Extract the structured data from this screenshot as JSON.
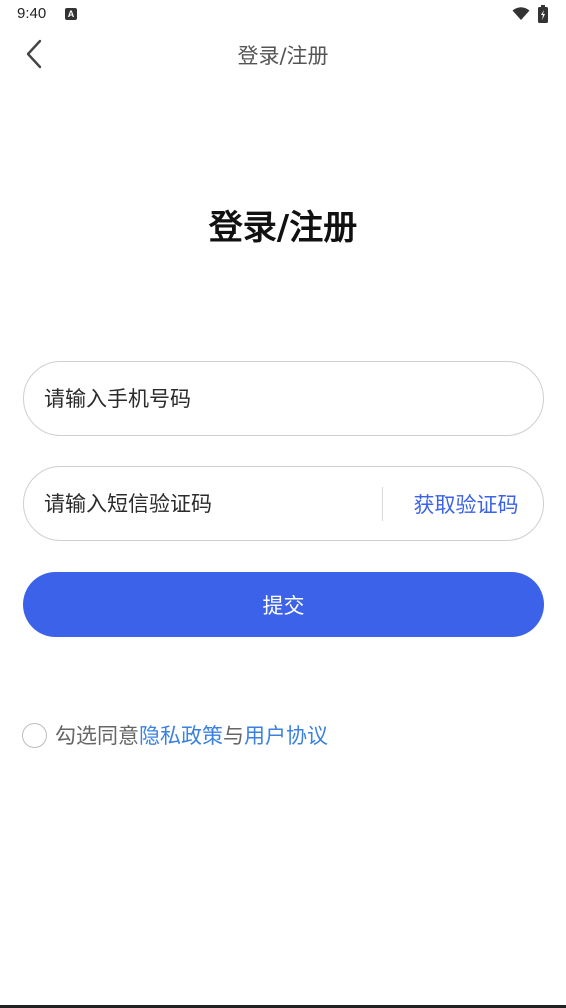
{
  "status_bar": {
    "time": "9:40",
    "notification_icon": "A",
    "wifi_icon": "wifi-icon",
    "battery_icon": "battery-charging-icon"
  },
  "nav": {
    "back_icon": "chevron-left-icon",
    "title": "登录/注册"
  },
  "heading": "登录/注册",
  "form": {
    "phone_placeholder": "请输入手机号码",
    "phone_value": "",
    "code_placeholder": "请输入短信验证码",
    "code_value": "",
    "get_code_label": "获取验证码",
    "submit_label": "提交"
  },
  "agreement": {
    "checked": false,
    "prefix": "勾选同意",
    "privacy_link": "隐私政策",
    "joiner": "与",
    "terms_link": "用户协议"
  },
  "colors": {
    "primary": "#3b62e8",
    "link": "#3b82e0",
    "border": "#cfcfcf"
  }
}
